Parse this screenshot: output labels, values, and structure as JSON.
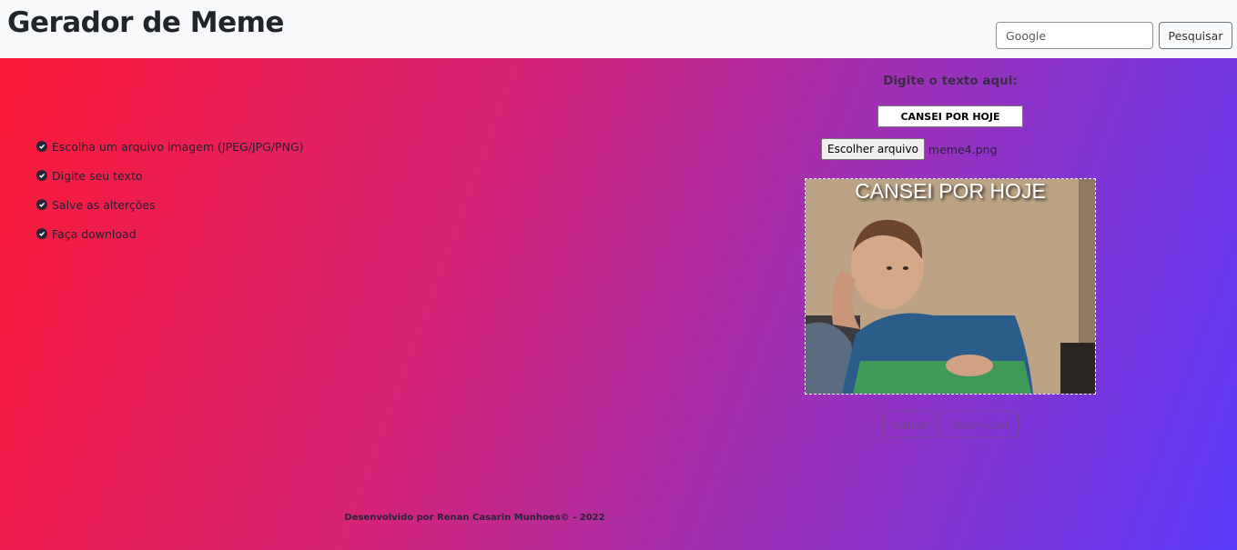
{
  "header": {
    "title": "Gerador de Meme",
    "search_placeholder": "Google",
    "search_button": "Pesquisar"
  },
  "steps": [
    {
      "icon": "check-circle-icon",
      "label": "Escolha um arquivo imagem (JPEG/JPG/PNG)"
    },
    {
      "icon": "check-circle-icon",
      "label": "Digite seu texto"
    },
    {
      "icon": "check-circle-icon",
      "label": "Salve as alterções"
    },
    {
      "icon": "check-circle-icon",
      "label": "Faça download"
    }
  ],
  "editor": {
    "prompt": "Digite o texto aqui:",
    "text_value": "CANSEI POR HOJE",
    "file_button": "Escolher arquivo",
    "file_name": "meme4.png",
    "caption": "CANSEI POR HOJE",
    "save_button": "Salvar",
    "download_button": "Download"
  },
  "footer": {
    "text": "Desenvolvido por Renan Casarin Munhoes© - 2022"
  },
  "colors": {
    "gradient_start": "#fc1a37",
    "gradient_end": "#5b3bfb",
    "navbar_bg": "#f8f9fa"
  }
}
